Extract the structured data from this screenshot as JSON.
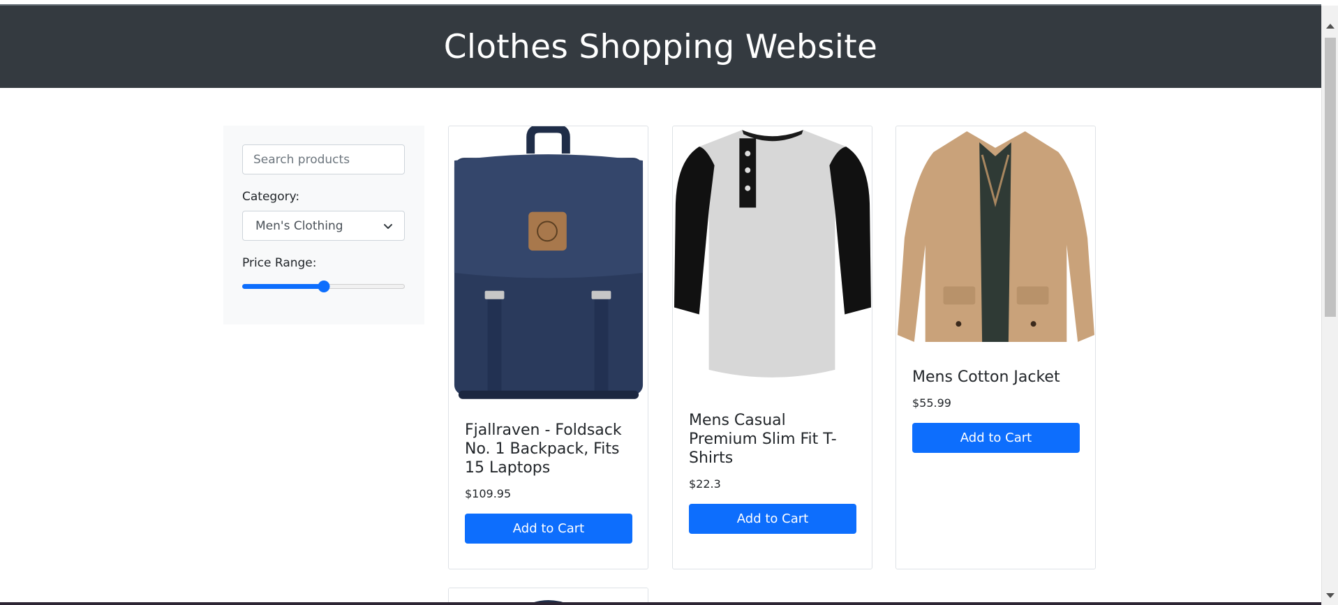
{
  "header": {
    "title": "Clothes Shopping Website"
  },
  "sidebar": {
    "search": {
      "placeholder": "Search products"
    },
    "category": {
      "label": "Category:",
      "selected": "Men's Clothing"
    },
    "price": {
      "label": "Price Range:",
      "level_percent": 50
    }
  },
  "products": [
    {
      "title": "Fjallraven - Foldsack No. 1 Backpack, Fits 15 Laptops",
      "price": "$109.95",
      "button": "Add to Cart",
      "icon": "backpack-image"
    },
    {
      "title": "Mens Casual Premium Slim Fit T-Shirts",
      "price": "$22.3",
      "button": "Add to Cart",
      "icon": "tshirt-image"
    },
    {
      "title": "Mens Cotton Jacket",
      "price": "$55.99",
      "button": "Add to Cart",
      "icon": "jacket-image"
    }
  ],
  "colors": {
    "header_bg": "#343a40",
    "primary": "#0d6efd",
    "sidebar_bg": "#f8f9fa"
  }
}
